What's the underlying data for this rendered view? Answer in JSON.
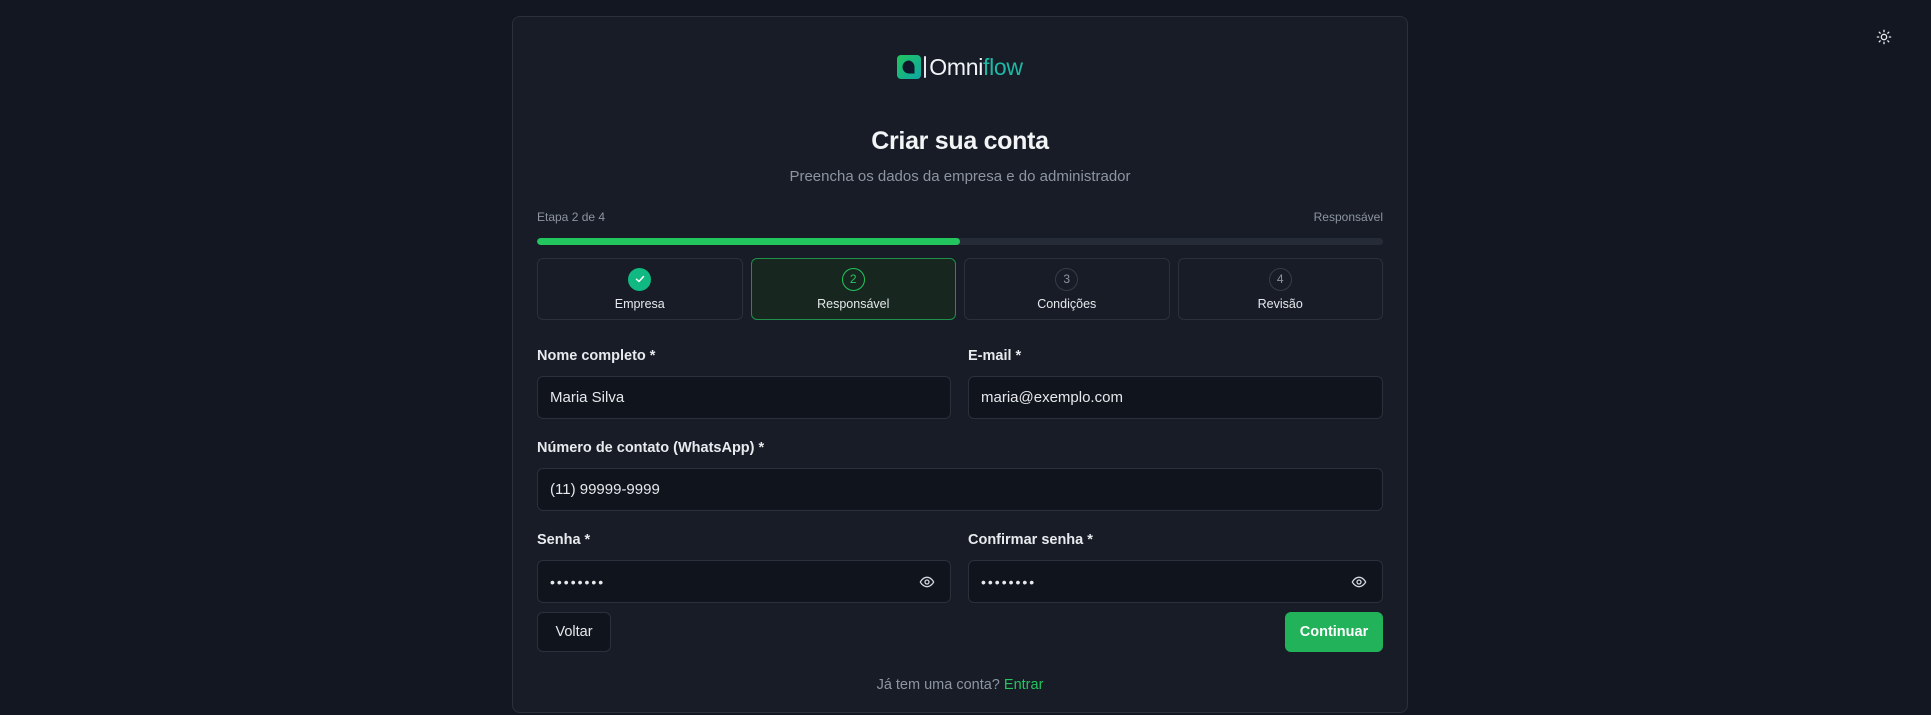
{
  "brand": {
    "name_part1": "Omni",
    "name_part2": "flow"
  },
  "header": {
    "title": "Criar sua conta",
    "subtitle": "Preencha os dados da empresa e do administrador"
  },
  "progress": {
    "step_text": "Etapa 2 de 4",
    "current_step_name": "Responsável",
    "fraction": 0.5
  },
  "steps": [
    {
      "number": "1",
      "label": "Empresa",
      "state": "done"
    },
    {
      "number": "2",
      "label": "Responsável",
      "state": "active"
    },
    {
      "number": "3",
      "label": "Condições",
      "state": "pending"
    },
    {
      "number": "4",
      "label": "Revisão",
      "state": "pending"
    }
  ],
  "form": {
    "full_name": {
      "label": "Nome completo *",
      "value": "Maria Silva"
    },
    "email": {
      "label": "E-mail *",
      "value": "maria@exemplo.com"
    },
    "phone": {
      "label": "Número de contato (WhatsApp) *",
      "value": "(11) 99999-9999"
    },
    "password": {
      "label": "Senha *",
      "value": "••••••••"
    },
    "confirm_password": {
      "label": "Confirmar senha *",
      "value": "••••••••"
    }
  },
  "actions": {
    "back_label": "Voltar",
    "continue_label": "Continuar"
  },
  "footer": {
    "prompt": "Já tem uma conta?",
    "link_label": "Entrar"
  },
  "colors": {
    "accent": "#22c55e",
    "background": "#121721",
    "card": "#171c26",
    "brand_teal": "#1fb8a6"
  },
  "icons": {
    "theme_toggle": "sun-icon",
    "password_visibility": "eye-icon",
    "step_done": "check-icon"
  }
}
